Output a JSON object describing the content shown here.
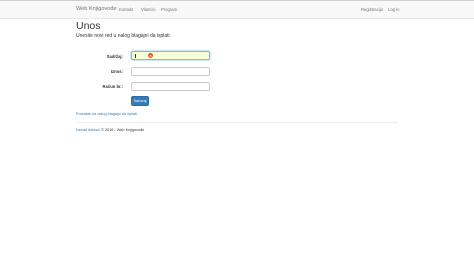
{
  "navbar": {
    "brand": "Web Knjigovođe",
    "links": [
      "Kontakt",
      "Vlasnici",
      "Program"
    ],
    "right_links": [
      "Registracija",
      "Log in"
    ]
  },
  "page": {
    "title": "Unos",
    "subtitle": "Unesite novi red u nalog blagajni da isplati"
  },
  "form": {
    "fields": [
      {
        "label": "Sadržaj:",
        "value": "",
        "focused": true
      },
      {
        "label": "Iznos:",
        "value": ""
      },
      {
        "label": "Račun br.:",
        "value": ""
      }
    ],
    "submit_label": "Sačuvaj"
  },
  "back_link": "Povratak na nalog blagajni da isplati",
  "footer": {
    "author": "Nenad Aleksić",
    "rest": " © 2016 - Web Knjigovođe"
  },
  "colors": {
    "link": "#337ab7",
    "button": "#337ab7",
    "focused_input_bg": "#f7ffd6",
    "error_icon": "#e05a2b"
  }
}
